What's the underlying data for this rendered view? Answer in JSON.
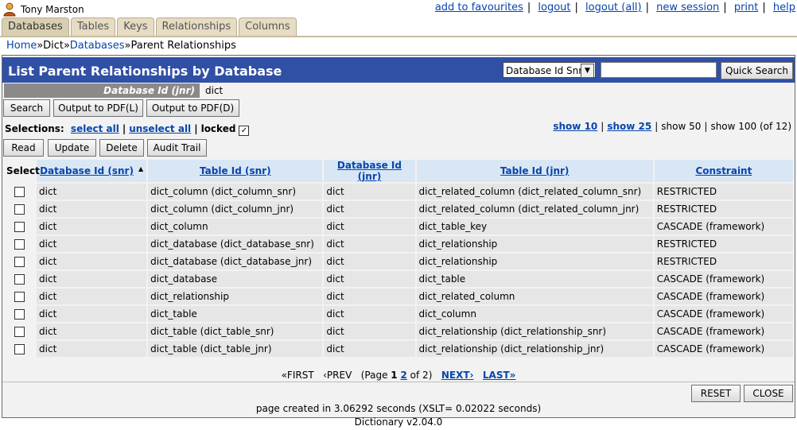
{
  "user": {
    "name": "Tony Marston"
  },
  "top_links": [
    "add to favourites",
    "logout",
    "logout (all)",
    "new session",
    "print",
    "help"
  ],
  "tabs": [
    "Databases",
    "Tables",
    "Keys",
    "Relationships",
    "Columns"
  ],
  "breadcrumb": {
    "home": "Home",
    "sep1": "»",
    "dict": "Dict",
    "sep2": "»",
    "databases": "Databases",
    "sep3": "»",
    "current": "Parent Relationships"
  },
  "title": "List Parent Relationships by Database",
  "quick_search": {
    "selected": "Database Id Snr",
    "value": "",
    "button": "Quick Search"
  },
  "filter": {
    "label": "Database Id (jnr)",
    "value": "dict"
  },
  "buttons1": {
    "search": "Search",
    "pdf_l": "Output to PDF(L)",
    "pdf_d": "Output to PDF(D)"
  },
  "selections": {
    "label": "Selections:",
    "select_all": "select all",
    "unselect_all": "unselect all",
    "locked": "locked",
    "pipe": "|"
  },
  "show": {
    "show10": "show 10",
    "show25": "show 25",
    "show50": "show 50",
    "show100": "show 100 (of 12)",
    "pipe": "|"
  },
  "buttons2": {
    "read": "Read",
    "update": "Update",
    "delete": "Delete",
    "audit": "Audit Trail"
  },
  "table": {
    "select_header": "Select",
    "headers": [
      "Database Id (snr)",
      "Table Id (snr)",
      "Database Id (jnr)",
      "Table Id (jnr)",
      "Constraint"
    ],
    "sort_arrow": "▲",
    "rows": [
      [
        "dict",
        "dict_column (dict_column_snr)",
        "dict",
        "dict_related_column (dict_related_column_snr)",
        "RESTRICTED"
      ],
      [
        "dict",
        "dict_column (dict_column_jnr)",
        "dict",
        "dict_related_column (dict_related_column_jnr)",
        "RESTRICTED"
      ],
      [
        "dict",
        "dict_column",
        "dict",
        "dict_table_key",
        "CASCADE (framework)"
      ],
      [
        "dict",
        "dict_database (dict_database_snr)",
        "dict",
        "dict_relationship",
        "RESTRICTED"
      ],
      [
        "dict",
        "dict_database (dict_database_jnr)",
        "dict",
        "dict_relationship",
        "RESTRICTED"
      ],
      [
        "dict",
        "dict_database",
        "dict",
        "dict_table",
        "CASCADE (framework)"
      ],
      [
        "dict",
        "dict_relationship",
        "dict",
        "dict_related_column",
        "CASCADE (framework)"
      ],
      [
        "dict",
        "dict_table",
        "dict",
        "dict_column",
        "CASCADE (framework)"
      ],
      [
        "dict",
        "dict_table (dict_table_snr)",
        "dict",
        "dict_relationship (dict_relationship_snr)",
        "CASCADE (framework)"
      ],
      [
        "dict",
        "dict_table (dict_table_jnr)",
        "dict",
        "dict_relationship (dict_relationship_jnr)",
        "CASCADE (framework)"
      ]
    ]
  },
  "pager": {
    "first": "«FIRST",
    "prev": "‹PREV",
    "page_pre": "(Page",
    "page1": "1",
    "page2": "2",
    "page_post": "of 2)",
    "next": "NEXT›",
    "last": "LAST»"
  },
  "bottom_buttons": {
    "reset": "RESET",
    "close": "CLOSE"
  },
  "created": "page created in 3.06292 seconds (XSLT= 0.02022 seconds)",
  "version": "Dictionary v2.04.0"
}
